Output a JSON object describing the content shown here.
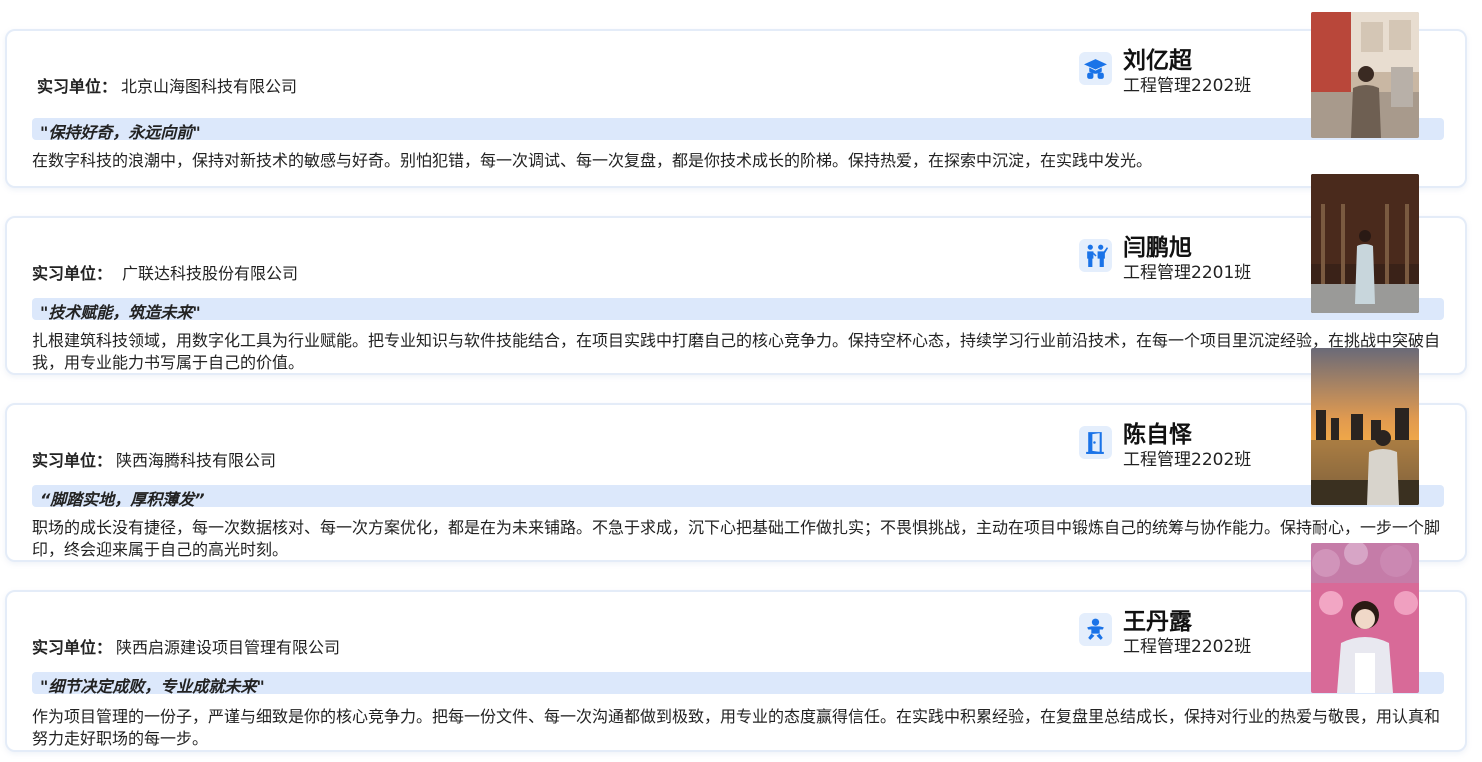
{
  "unit_label": "实习单位：",
  "cards": [
    {
      "unit": "北京山海图科技有限公司",
      "quote": "\"保持好奇，永远向前\"",
      "desc": "在数字科技的浪潮中，保持对新技术的敏感与好奇。别怕犯错，每一次调试、每一次复盘，都是你技术成长的阶梯。保持热爱，在探索中沉淀，在实践中发光。",
      "name": "刘亿超",
      "class": "工程管理2202班",
      "icon": "graduate-icon"
    },
    {
      "unit": "广联达科技股份有限公司",
      "quote": "\"技术赋能，筑造未来\"",
      "desc": "扎根建筑科技领域，用数字化工具为行业赋能。把专业知识与软件技能结合，在项目实践中打磨自己的核心竞争力。保持空杯心态，持续学习行业前沿技术，在每一个项目里沉淀经验，在挑战中突破自我，用专业能力书写属于自己的价值。",
      "name": "闫鹏旭",
      "class": "工程管理2201班",
      "icon": "people-icon"
    },
    {
      "unit": "陕西海腾科技有限公司",
      "quote": "“脚踏实地，厚积薄发”",
      "desc": "职场的成长没有捷径，每一次数据核对、每一次方案优化，都是在为未来铺路。不急于求成，沉下心把基础工作做扎实；不畏惧挑战，主动在项目中锻炼自己的统筹与协作能力。保持耐心，一步一个脚印，终会迎来属于自己的高光时刻。",
      "name": "陈自怿",
      "class": "工程管理2202班",
      "icon": "door-icon"
    },
    {
      "unit": "陕西启源建设项目管理有限公司",
      "quote": "\"细节决定成败，专业成就未来\"",
      "desc": "作为项目管理的一份子，严谨与细致是你的核心竞争力。把每一份文件、每一次沟通都做到极致，用专业的态度赢得信任。在实践中积累经验，在复盘里总结成长，保持对行业的热爱与敬畏，用认真和努力走好职场的每一步。",
      "name": "王丹露",
      "class": "工程管理2202班",
      "icon": "baby-icon"
    }
  ],
  "colors": {
    "accent": "#1a73e8",
    "quote_bg": "#dce8fb",
    "border": "#e4ecf8"
  }
}
